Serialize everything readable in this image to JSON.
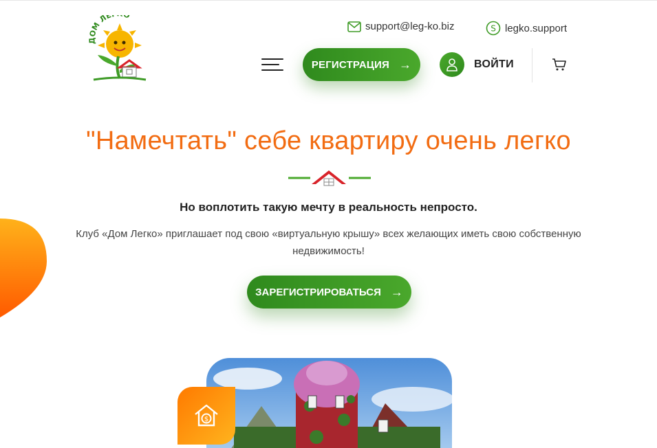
{
  "header": {
    "logo_text": "ДОМ ЛЕГКО",
    "email": "support@leg-ko.biz",
    "skype": "legko.support",
    "register_label": "РЕГИСТРАЦИЯ",
    "register_arrow": "→",
    "login_label": "ВОЙТИ"
  },
  "hero": {
    "title": "\"Намечтать\" себе квартиру очень легко",
    "subtitle": "Но воплотить такую мечту в реальность непросто.",
    "description": "Клуб «Дом Легко» приглашает под свою «виртуальную крышу» всех желающих иметь свою собственную недвижимость!",
    "cta_label": "ЗАРЕГИСТРИРОВАТЬСЯ",
    "cta_arrow": "→"
  },
  "colors": {
    "accent_orange": "#f26c12",
    "green": "#3d9a25",
    "roof_red": "#d8232a"
  },
  "icons": [
    "email-icon",
    "skype-icon",
    "menu-icon",
    "user-icon",
    "cart-icon",
    "house-money-icon"
  ]
}
